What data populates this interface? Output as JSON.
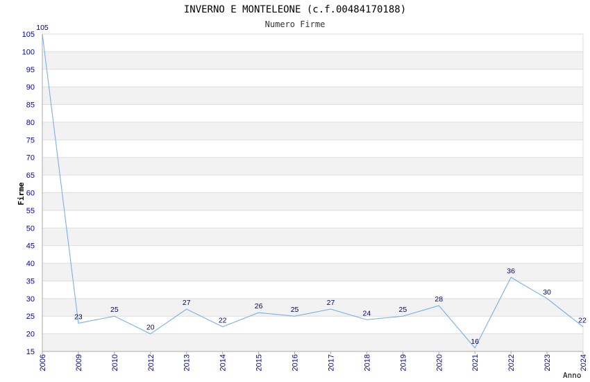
{
  "chart_data": {
    "type": "line",
    "title": "INVERNO E MONTELEONE (c.f.00484170188)",
    "subtitle": "Numero Firme",
    "xlabel": "Anno",
    "ylabel": "Firme",
    "categories": [
      "2006",
      "2009",
      "2010",
      "2012",
      "2013",
      "2014",
      "2015",
      "2016",
      "2017",
      "2018",
      "2019",
      "2020",
      "2021",
      "2022",
      "2023",
      "2024"
    ],
    "values": [
      105,
      23,
      25,
      20,
      27,
      22,
      26,
      25,
      27,
      24,
      25,
      28,
      16,
      36,
      30,
      22
    ],
    "value_labels": [
      "105",
      "23",
      "25",
      "20",
      "27",
      "22",
      "26",
      "25",
      "27",
      "24",
      "25",
      "28",
      "16",
      "36",
      "30",
      "22"
    ],
    "yticks": [
      "15",
      "20",
      "25",
      "30",
      "35",
      "40",
      "45",
      "50",
      "55",
      "60",
      "65",
      "70",
      "75",
      "80",
      "85",
      "90",
      "95",
      "100",
      "105"
    ],
    "ylim": [
      15,
      105
    ],
    "grid": true,
    "legend": "none",
    "colors": {
      "line": "#6aaaf0",
      "tick_labels": "#0000aa",
      "data_labels": "#000066",
      "band_alt": "#f2f2f2",
      "grid": "#dddddd",
      "axis": "#aaaaaa"
    }
  }
}
